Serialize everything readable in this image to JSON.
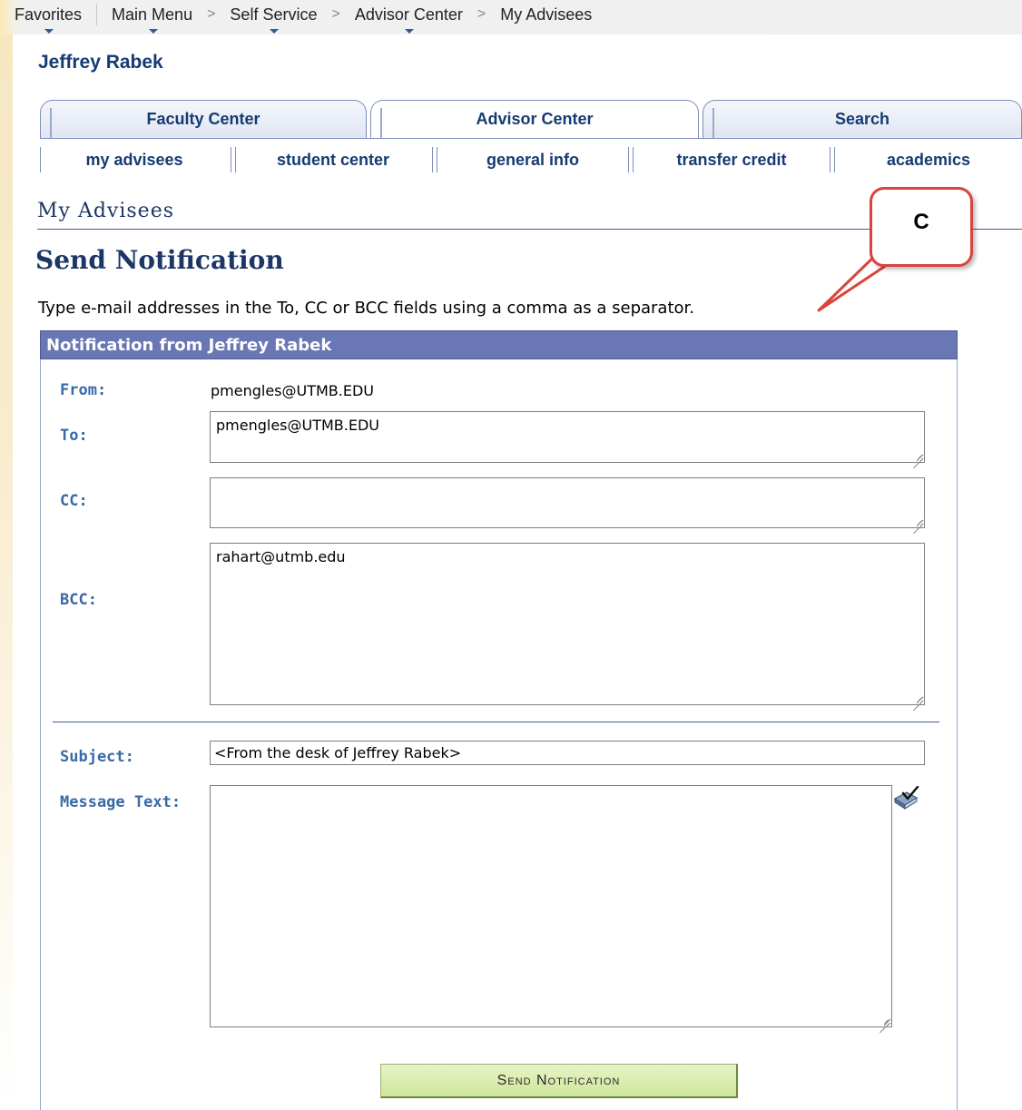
{
  "breadcrumb": {
    "items": [
      "Favorites",
      "Main Menu",
      "Self Service",
      "Advisor Center",
      "My Advisees"
    ],
    "separator": ">"
  },
  "user": {
    "name": "Jeffrey Rabek"
  },
  "tabs": [
    {
      "label": "Faculty Center",
      "active": false
    },
    {
      "label": "Advisor Center",
      "active": true
    },
    {
      "label": "Search",
      "active": false
    }
  ],
  "subtabs": [
    {
      "label": "my advisees",
      "active": true
    },
    {
      "label": "student center"
    },
    {
      "label": "general info"
    },
    {
      "label": "transfer credit"
    },
    {
      "label": "academics"
    }
  ],
  "page": {
    "title": "My Advisees",
    "section_title": "Send Notification",
    "instructions": "Type e-mail addresses in the To, CC or BCC fields using a comma as a separator."
  },
  "callout": {
    "label": "C",
    "color": "#d9443c"
  },
  "form": {
    "header": "Notification from Jeffrey Rabek",
    "from_label": "From:",
    "from_value": "pmengles@UTMB.EDU",
    "to_label": "To:",
    "to_value": "pmengles@UTMB.EDU",
    "cc_label": "CC:",
    "cc_value": "",
    "bcc_label": "BCC:",
    "bcc_value": "rahart@utmb.edu",
    "subject_label": "Subject:",
    "subject_value": "<From the desk of Jeffrey Rabek>",
    "message_label": "Message Text:",
    "message_value": "",
    "spellcheck_icon": "spell-check-icon",
    "send_button": "Send Notification"
  },
  "colors": {
    "header_bg": "#6977b4",
    "label": "#3a6aa6",
    "title": "#1c3666",
    "button_bg": "#d0e59a"
  }
}
